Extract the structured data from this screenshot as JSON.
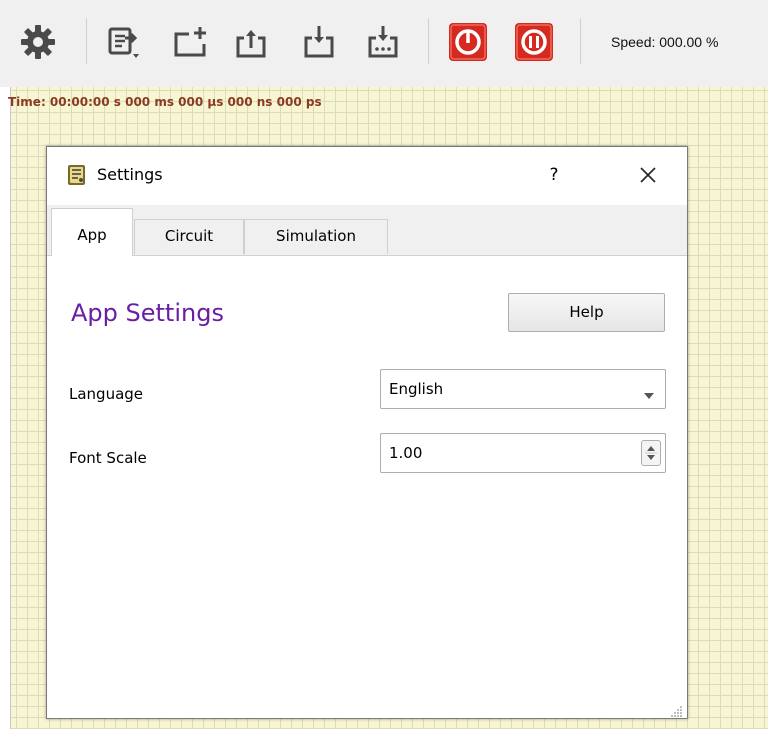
{
  "toolbar": {
    "icons": [
      "gear-icon",
      "export-menu-icon",
      "new-circuit-icon",
      "open-circuit-icon",
      "save-circuit-icon",
      "save-as-icon",
      "power-icon",
      "pause-icon"
    ],
    "speed_text": "Speed: 000.00 %"
  },
  "canvas": {
    "time_text": "Time: 00:00:00 s  000 ms  000 µs  000 ns  000 ps",
    "background_color": "#f8f5d2",
    "time_color": "#8a3b24"
  },
  "dialog": {
    "title": "Settings",
    "help_symbol": "?",
    "tabs": [
      {
        "label": "App",
        "active": true
      },
      {
        "label": "Circuit",
        "active": false
      },
      {
        "label": "Simulation",
        "active": false
      }
    ],
    "section_title": "App Settings",
    "section_title_color": "#6b1ea4",
    "help_button": "Help",
    "language": {
      "label": "Language",
      "value": "English"
    },
    "font_scale": {
      "label": "Font Scale",
      "value": "1.00"
    }
  },
  "colors": {
    "power_button": "#d42a20"
  }
}
